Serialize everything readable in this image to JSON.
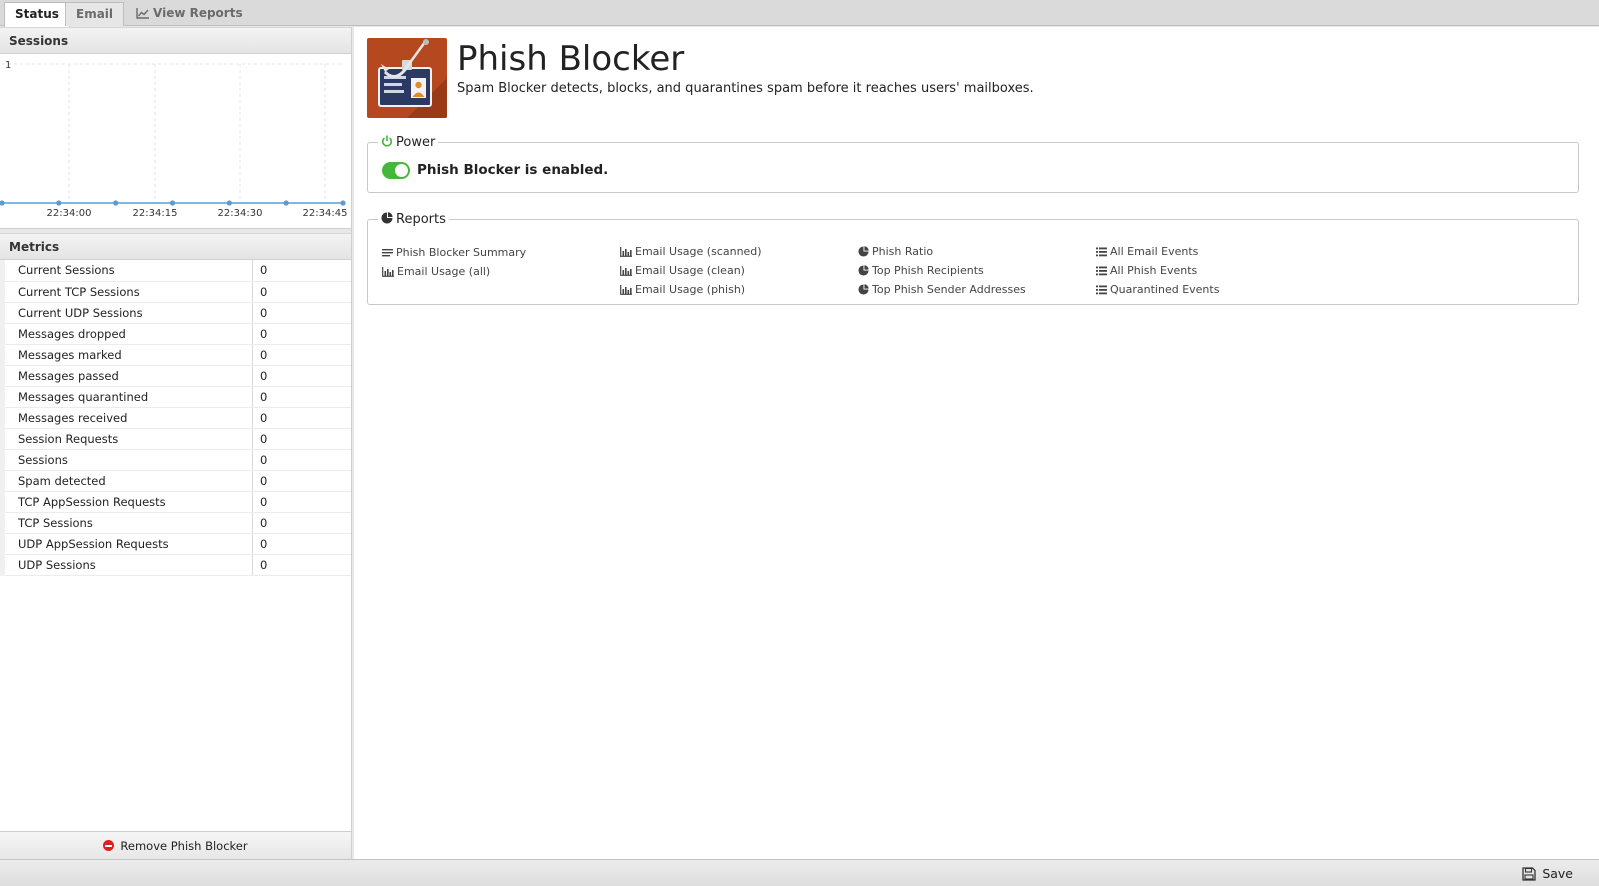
{
  "tabs": [
    {
      "label": "Status"
    },
    {
      "label": "Email"
    },
    {
      "label": "View Reports"
    }
  ],
  "sessions": {
    "title": "Sessions",
    "chart_data": {
      "type": "line",
      "title": "",
      "y_tick": "1",
      "x_ticks": [
        "22:34:00",
        "22:34:15",
        "22:34:30",
        "22:34:45"
      ],
      "ylim": [
        0,
        1
      ],
      "grid": true,
      "series": [
        {
          "values": [
            0,
            0,
            0,
            0,
            0,
            0,
            0
          ]
        }
      ]
    }
  },
  "metrics": {
    "title": "Metrics",
    "rows": [
      {
        "name": "Current Sessions",
        "value": "0"
      },
      {
        "name": "Current TCP Sessions",
        "value": "0"
      },
      {
        "name": "Current UDP Sessions",
        "value": "0"
      },
      {
        "name": "Messages dropped",
        "value": "0"
      },
      {
        "name": "Messages marked",
        "value": "0"
      },
      {
        "name": "Messages passed",
        "value": "0"
      },
      {
        "name": "Messages quarantined",
        "value": "0"
      },
      {
        "name": "Messages received",
        "value": "0"
      },
      {
        "name": "Session Requests",
        "value": "0"
      },
      {
        "name": "Sessions",
        "value": "0"
      },
      {
        "name": "Spam detected",
        "value": "0"
      },
      {
        "name": "TCP AppSession Requests",
        "value": "0"
      },
      {
        "name": "TCP Sessions",
        "value": "0"
      },
      {
        "name": "UDP AppSession Requests",
        "value": "0"
      },
      {
        "name": "UDP Sessions",
        "value": "0"
      }
    ]
  },
  "remove_label": "Remove Phish Blocker",
  "app": {
    "title": "Phish Blocker",
    "description": "Spam Blocker detects, blocks, and quarantines spam before it reaches users' mailboxes.",
    "icon": "phish-blocker-icon"
  },
  "power": {
    "legend": "Power",
    "status_text": "Phish Blocker is enabled.",
    "enabled": true,
    "toggle_color": "#43b83b"
  },
  "reports": {
    "legend": "Reports",
    "columns": [
      [
        {
          "label": "Phish Blocker Summary",
          "icon": "text-lines-icon"
        },
        {
          "label": "Email Usage (all)",
          "icon": "bar-chart-icon"
        }
      ],
      [
        {
          "label": "Email Usage (scanned)",
          "icon": "bar-chart-icon"
        },
        {
          "label": "Email Usage (clean)",
          "icon": "bar-chart-icon"
        },
        {
          "label": "Email Usage (phish)",
          "icon": "bar-chart-icon"
        }
      ],
      [
        {
          "label": "Phish Ratio",
          "icon": "pie-chart-icon"
        },
        {
          "label": "Top Phish Recipients",
          "icon": "pie-chart-icon"
        },
        {
          "label": "Top Phish Sender Addresses",
          "icon": "pie-chart-icon"
        }
      ],
      [
        {
          "label": "All Email Events",
          "icon": "list-icon"
        },
        {
          "label": "All Phish Events",
          "icon": "list-icon"
        },
        {
          "label": "Quarantined Events",
          "icon": "list-icon"
        }
      ]
    ]
  },
  "save_label": "Save",
  "colors": {
    "accent_green": "#43b83b",
    "remove_red": "#e21d1d",
    "chart_line": "#5b9bd5",
    "icon_bg": "#b6481f"
  }
}
